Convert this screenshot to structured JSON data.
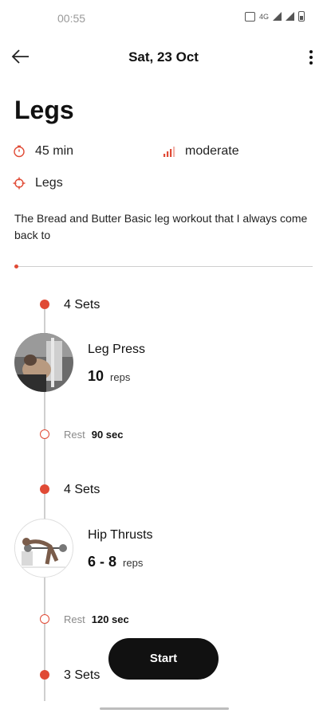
{
  "status_bar": {
    "time": "00:55",
    "network_label": "4G"
  },
  "app_bar": {
    "date": "Sat, 23 Oct"
  },
  "workout": {
    "title": "Legs",
    "duration": "45 min",
    "intensity": "moderate",
    "target": "Legs",
    "description": "The Bread and Butter Basic leg workout that I always come back to"
  },
  "exercises": [
    {
      "sets": "4 Sets",
      "name": "Leg Press",
      "reps_value": "10",
      "reps_unit": "reps",
      "rest_label": "Rest",
      "rest_value": "90 sec"
    },
    {
      "sets": "4 Sets",
      "name": "Hip Thrusts",
      "reps_value": "6 - 8",
      "reps_unit": "reps",
      "rest_label": "Rest",
      "rest_value": "120 sec"
    },
    {
      "sets": "3 Sets"
    }
  ],
  "actions": {
    "start_label": "Start"
  },
  "progress": {
    "fraction": 0.0
  },
  "colors": {
    "accent": "#e04a35",
    "button": "#111111",
    "line": "#cfcfcf"
  },
  "icons": {
    "back": "arrow-left-icon",
    "more": "more-vertical-icon",
    "duration": "timer-icon",
    "intensity": "signal-bars-icon",
    "target": "crosshair-icon"
  }
}
